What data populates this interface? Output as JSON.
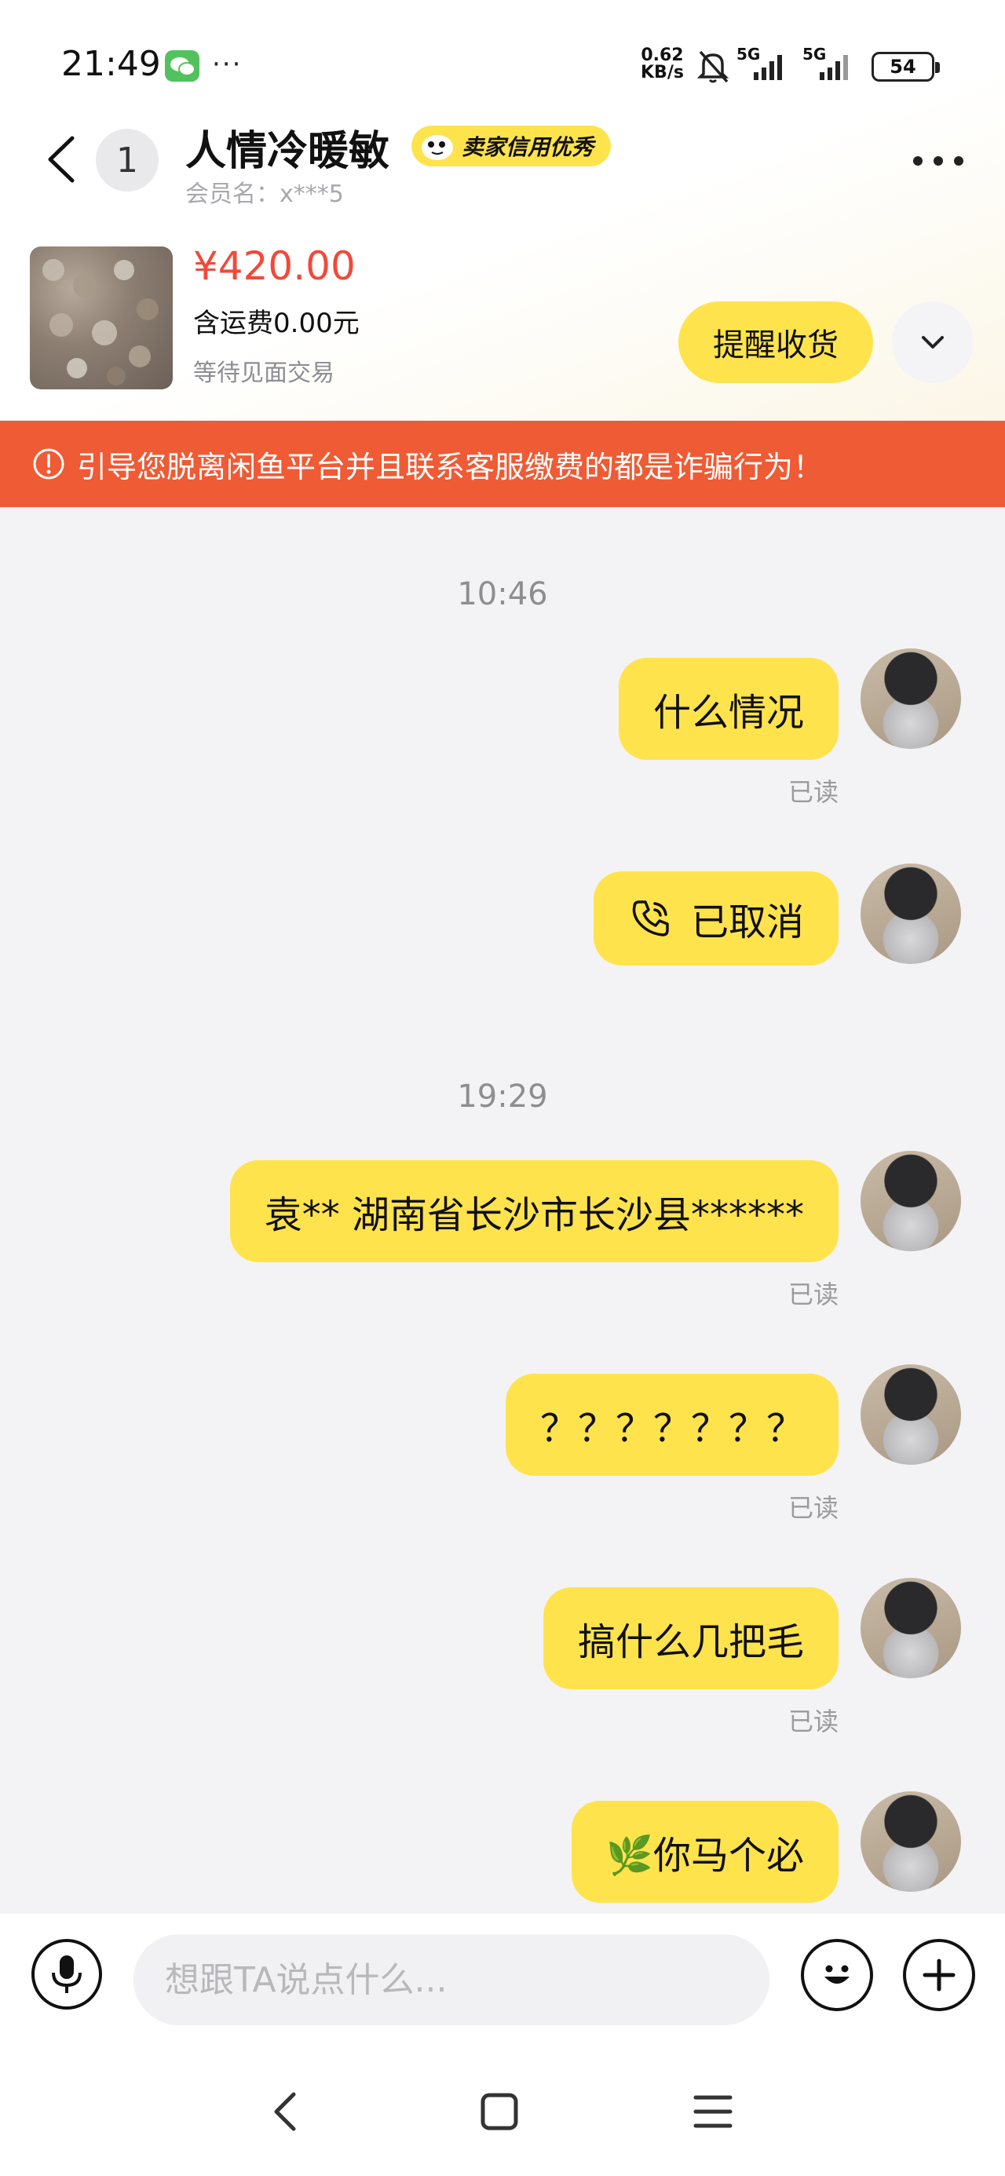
{
  "status_bar": {
    "time": "21:49",
    "net_speed_value": "0.62",
    "net_speed_unit": "KB/s",
    "signal1_label": "5G",
    "signal2_label": "5G",
    "battery": "54",
    "icons": [
      "wechat-icon",
      "more-dots-icon",
      "bell-muted-icon",
      "signal-icon",
      "battery-icon"
    ]
  },
  "header": {
    "unread_count": "1",
    "contact_name": "人情冷暖敏",
    "credit_badge": "卖家信用优秀",
    "member_label": "会员名：x***5"
  },
  "product": {
    "price": "¥420.00",
    "shipping": "含运费0.00元",
    "status": "等待见面交易",
    "remind_button": "提醒收货"
  },
  "warning": {
    "text": "引导您脱离闲鱼平台并且联系客服缴费的都是诈骗行为！"
  },
  "chat": {
    "time_1": "10:46",
    "time_2": "19:29",
    "messages": [
      {
        "text": "什么情况",
        "read": "已读"
      },
      {
        "text": "已取消"
      },
      {
        "text": "袁**  湖南省长沙市长沙县******",
        "read": "已读"
      },
      {
        "text": "？？？？？？？",
        "read": "已读"
      },
      {
        "text": "搞什么几把毛",
        "read": "已读"
      },
      {
        "text": "🌿你马个必"
      }
    ]
  },
  "input": {
    "placeholder": "想跟TA说点什么..."
  },
  "colors": {
    "accent_yellow": "#ffe34d",
    "warning_orange": "#ee5b35",
    "price_red": "#f04a3a"
  }
}
